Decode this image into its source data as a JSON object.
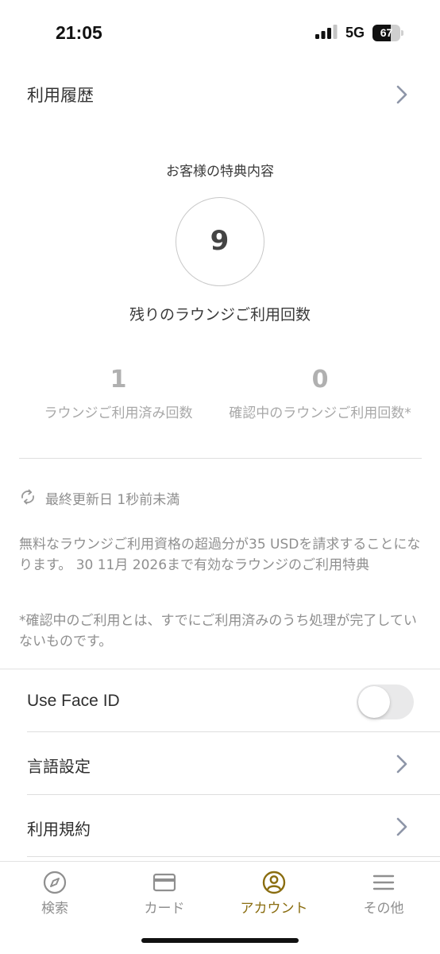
{
  "status": {
    "time": "21:05",
    "network": "5G",
    "battery_percent": 67
  },
  "history": {
    "label": "利用履歴"
  },
  "benefits": {
    "title": "お客様の特典内容",
    "remaining_count": "9",
    "remaining_label": "残りのラウンジご利用回数",
    "used_count": "1",
    "used_label": "ラウンジご利用済み回数",
    "pending_count": "0",
    "pending_label": "確認中のラウンジご利用回数*"
  },
  "updated": {
    "text": "最終更新日 1秒前未満"
  },
  "notes": {
    "fee_note": "無料なラウンジご利用資格の超過分が35 USDを請求することになります。 30 11月 2026まで有効なラウンジのご利用特典",
    "pending_note": "*確認中のご利用とは、すでにご利用済みのうち処理が完了していないものです。"
  },
  "settings": {
    "face_id": {
      "label": "Use Face ID",
      "enabled": false
    },
    "language": {
      "label": "言語設定"
    },
    "terms": {
      "label": "利用規約"
    }
  },
  "tabbar": {
    "tabs": [
      {
        "label": "検索",
        "icon": "compass-icon",
        "active": false
      },
      {
        "label": "カード",
        "icon": "card-icon",
        "active": false
      },
      {
        "label": "アカウント",
        "icon": "account-icon",
        "active": true
      },
      {
        "label": "その他",
        "icon": "menu-icon",
        "active": false
      }
    ]
  },
  "colors": {
    "accent": "#8a6d10",
    "muted_text": "#8f8f8f",
    "divider": "#dedede"
  }
}
